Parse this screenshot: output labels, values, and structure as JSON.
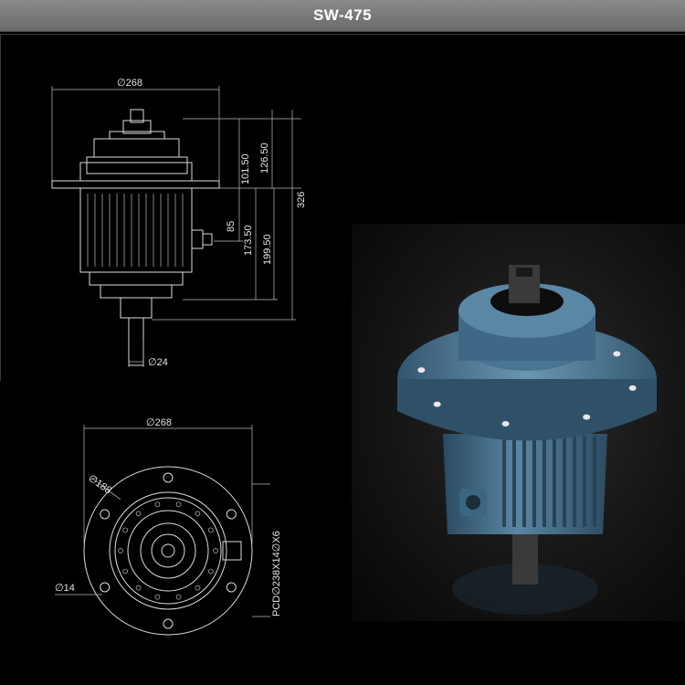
{
  "header": {
    "title": "SW-475"
  },
  "side_view": {
    "dims": {
      "top_diameter": "∅268",
      "d1": "101.50",
      "d2": "126.50",
      "d3": "326",
      "d4": "85",
      "d5": "173.50",
      "d6": "199.50",
      "shaft_diameter": "∅24"
    }
  },
  "plan_view": {
    "dims": {
      "outer_diameter": "∅268",
      "inner_diameter": "∅188",
      "hole_diameter": "∅14",
      "pcd": "PCD∅238X14∅X6"
    }
  },
  "colors": {
    "motor_body": "#3f6a86",
    "motor_dark": "#2a4a60",
    "shaft": "#3a3a3a"
  }
}
